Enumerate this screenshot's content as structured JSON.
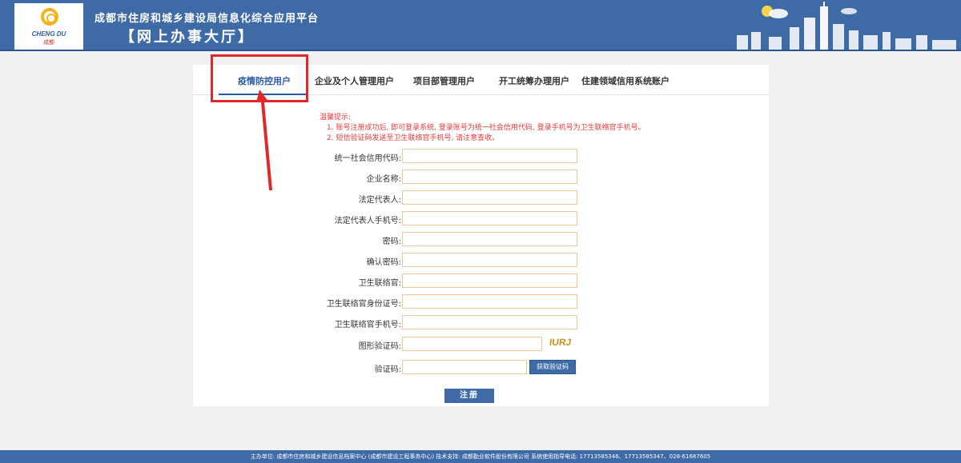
{
  "header": {
    "logo_en": "CHENG DU",
    "logo_cn": "成都",
    "title": "成都市住房和城乡建设局信息化综合应用平台",
    "subtitle": "【网上办事大厅】"
  },
  "tabs": [
    {
      "label": "疫情防控用户",
      "active": true
    },
    {
      "label": "企业及个人管理用户"
    },
    {
      "label": "项目部管理用户"
    },
    {
      "label": "开工统筹办理用户"
    },
    {
      "label": "住建领域信用系统账户"
    }
  ],
  "hint": {
    "title": "温馨提示:",
    "lines": [
      "1. 账号注册成功后, 即可登录系统, 登录账号为统一社会信用代码, 登录手机号为卫生联络官手机号。",
      "2. 短信验证码发送至卫生联络官手机号, 请注意查收。"
    ]
  },
  "form": {
    "fields": [
      {
        "label": "统一社会信用代码:",
        "value": ""
      },
      {
        "label": "企业名称:",
        "value": ""
      },
      {
        "label": "法定代表人:",
        "value": ""
      },
      {
        "label": "法定代表人手机号:",
        "value": ""
      },
      {
        "label": "密码:",
        "value": ""
      },
      {
        "label": "确认密码:",
        "value": ""
      },
      {
        "label": "卫生联络官:",
        "value": ""
      },
      {
        "label": "卫生联络官身份证号:",
        "value": ""
      },
      {
        "label": "卫生联络官手机号:",
        "value": ""
      }
    ],
    "captcha": {
      "label": "图形验证码:",
      "value": "",
      "image_text": "IURJ"
    },
    "sms": {
      "label": "验证码:",
      "value": "",
      "button": "获取验证码"
    },
    "submit": "注册"
  },
  "footer": "主办单位: 成都市住房和城乡建设信息档案中心 (成都市建设工程事务中心)    技术支持: 成都勤业软件股份有限公司    系统使用指导电话: 17713585346、17713585347、028-61687605",
  "colors": {
    "brand": "#3e6aa6",
    "hint": "#e63a3a",
    "annotation": "#e0282a"
  }
}
